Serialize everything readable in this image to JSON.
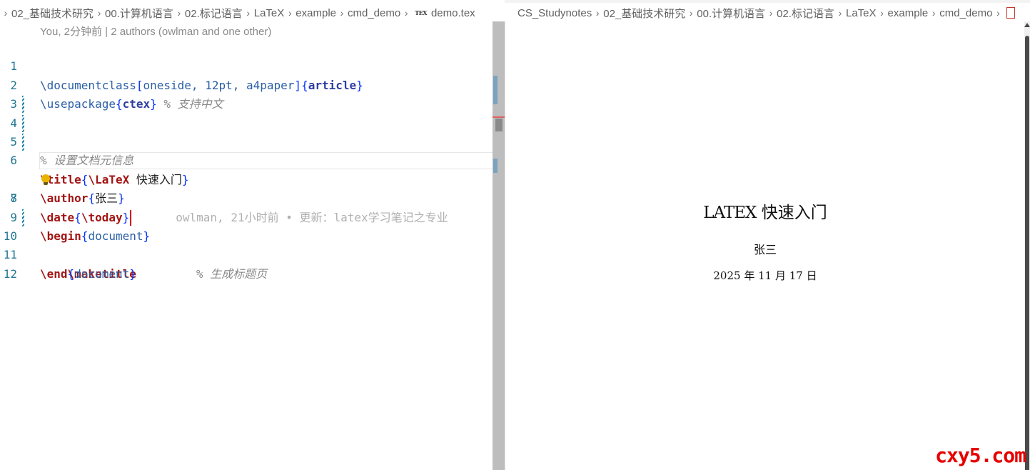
{
  "editor": {
    "breadcrumb": [
      "02_基础技术研究",
      "00.计算机语言",
      "02.标记语言",
      "LaTeX",
      "example",
      "cmd_demo"
    ],
    "file_icon": "TEX",
    "file_name": "demo.tex",
    "codelens": "You, 2分钟前 | 2 authors (owlman and one other)",
    "line_numbers": [
      "1",
      "2",
      "3",
      "4",
      "5",
      "6",
      "7",
      "8",
      "9",
      "10",
      "11",
      "12"
    ],
    "lines": {
      "l1": {
        "cmd": "\\documentclass",
        "b1": "[",
        "opt": "oneside, 12pt, a4paper",
        "b2": "]",
        "b3": "{",
        "arg": "article",
        "b4": "}"
      },
      "l2": {
        "cmd": "\\usepackage",
        "b1": "{",
        "arg": "ctex",
        "b2": "}",
        "comment": " % 支持中文"
      },
      "l4": {
        "comment": "% 设置文档元信息"
      },
      "l5": {
        "cmd": "\\title",
        "b1": "{",
        "inner": "\\LaTeX",
        "text": " 快速入门",
        "b2": "}"
      },
      "l6": {
        "cmd": "\\author",
        "b1": "{",
        "text": "张三",
        "b2": "}"
      },
      "l7": {
        "cmd": "\\date",
        "b1": "{",
        "inner": "\\today",
        "b2": "}",
        "blame": "owlman, 21小时前 • 更新：latex学习笔记之专业"
      },
      "l9": {
        "cmd": "\\begin",
        "b1": "{",
        "arg": "document",
        "b2": "}"
      },
      "l10": {
        "indent": "    ",
        "cmd": "\\maketitle",
        "comment": "% 生成标题页"
      },
      "l11": {
        "cmd": "\\end",
        "b1": "{",
        "arg": "document",
        "b2": "}"
      }
    }
  },
  "preview": {
    "breadcrumb": [
      "CS_Studynotes",
      "02_基础技术研究",
      "00.计算机语言",
      "02.标记语言",
      "LaTeX",
      "example",
      "cmd_demo"
    ],
    "title_logo": "LATEX",
    "title_text": "快速入门",
    "author": "张三",
    "date": "2025 年 11 月 17 日",
    "watermark": "cxy5.com"
  },
  "colors": {
    "command": "#a31515",
    "bracket": "#0431fa",
    "comment": "#8a8a8a",
    "line_number": "#237893",
    "watermark": "#e60000"
  },
  "icons": [
    "chevron-right-icon",
    "tex-file-icon",
    "lightbulb-icon",
    "pdf-file-icon"
  ]
}
